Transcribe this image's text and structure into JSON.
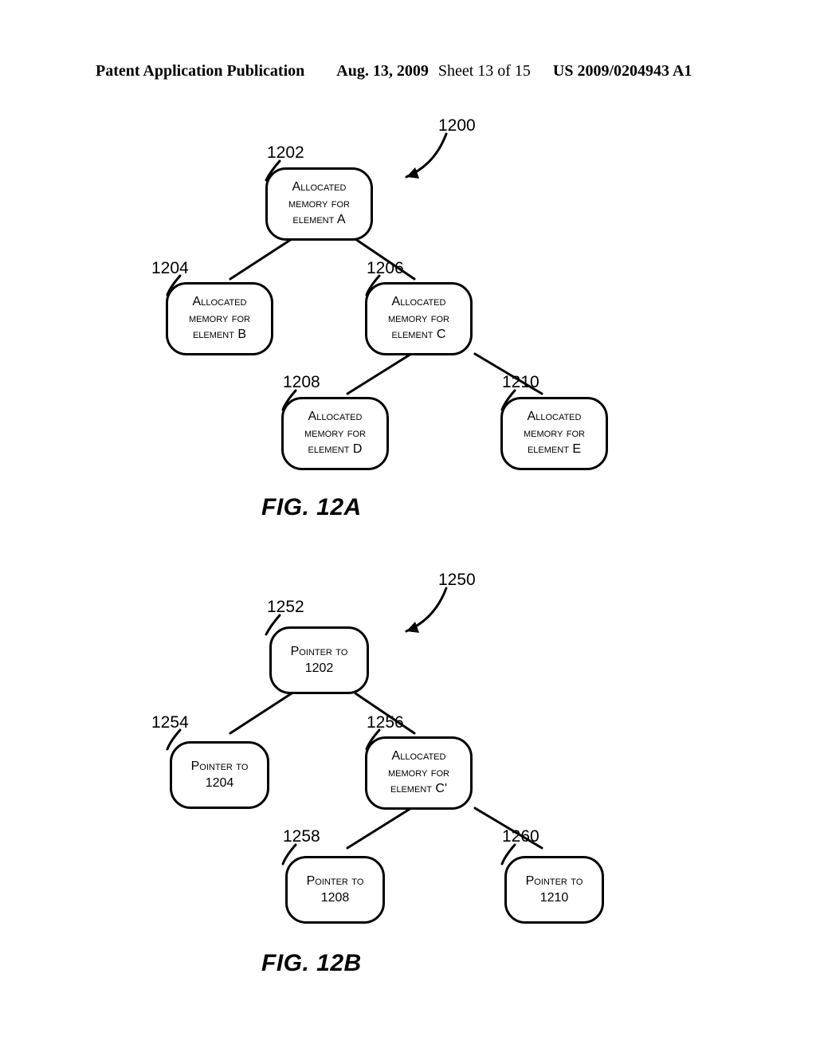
{
  "header": {
    "left": "Patent Application Publication",
    "date": "Aug. 13, 2009",
    "sheet": "Sheet 13 of 15",
    "pubnum": "US 2009/0204943 A1"
  },
  "figA": {
    "label": "FIG. 12A",
    "ref": {
      "tree": "1200",
      "a": "1202",
      "b": "1204",
      "c": "1206",
      "d": "1208",
      "e": "1210"
    },
    "nodes": {
      "a": "Allocated memory for element A",
      "b": "Allocated memory for element B",
      "c": "Allocated memory for element C",
      "d": "Allocated memory for element D",
      "e": "Allocated memory for element E"
    }
  },
  "figB": {
    "label": "FIG. 12B",
    "ref": {
      "tree": "1250",
      "a": "1252",
      "b": "1254",
      "c": "1256",
      "d": "1258",
      "e": "1260"
    },
    "nodes": {
      "a": "Pointer to 1202",
      "b": "Pointer to 1204",
      "c": "Allocated memory for element C'",
      "d": "Pointer to 1208",
      "e": "Pointer to 1210"
    }
  }
}
